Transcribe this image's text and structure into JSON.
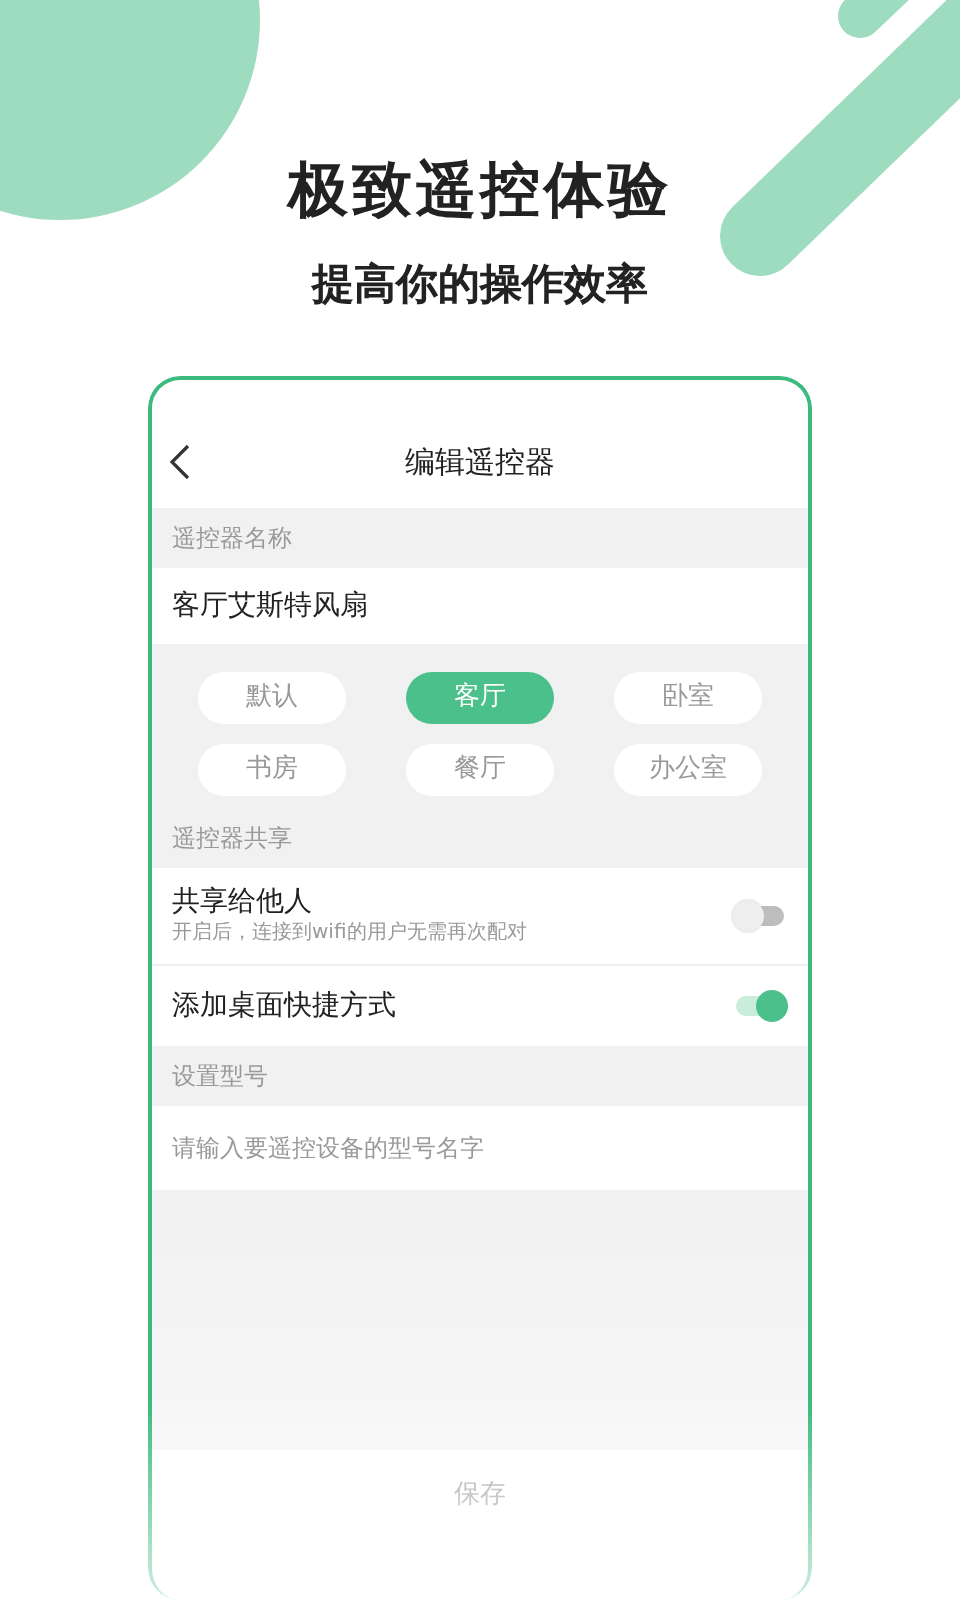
{
  "headline": "极致遥控体验",
  "subheadline": "提高你的操作效率",
  "screen": {
    "title": "编辑遥控器",
    "name_label": "遥控器名称",
    "name_value": "客厅艾斯特风扇",
    "rooms": [
      {
        "label": "默认",
        "selected": false
      },
      {
        "label": "客厅",
        "selected": true
      },
      {
        "label": "卧室",
        "selected": false
      },
      {
        "label": "书房",
        "selected": false
      },
      {
        "label": "餐厅",
        "selected": false
      },
      {
        "label": "办公室",
        "selected": false
      }
    ],
    "share_label": "遥控器共享",
    "settings": [
      {
        "title": "共享给他人",
        "subtitle": "开启后，连接到wifi的用户无需再次配对",
        "on": false
      },
      {
        "title": "添加桌面快捷方式",
        "on": true
      }
    ],
    "model_label": "设置型号",
    "model_placeholder": "请输入要遥控设备的型号名字",
    "save_button": "保存"
  }
}
